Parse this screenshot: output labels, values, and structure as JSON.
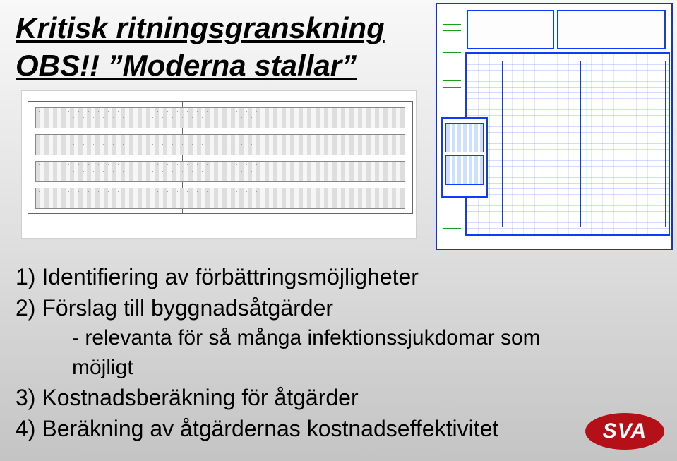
{
  "title": {
    "line1": "Kritisk ritningsgranskning",
    "line2": "OBS!! ”Moderna stallar”"
  },
  "body": {
    "p1": "1) Identifiering av förbättringsmöjligheter",
    "p2": "2) Förslag till byggnadsåtgärder",
    "sub": "- relevanta för så många infektionssjukdomar som möjligt",
    "p3": "3) Kostnadsberäkning för åtgärder",
    "p4": "4) Beräkning av åtgärdernas kostnadseffektivitet"
  },
  "logo": {
    "text": "SVA"
  }
}
